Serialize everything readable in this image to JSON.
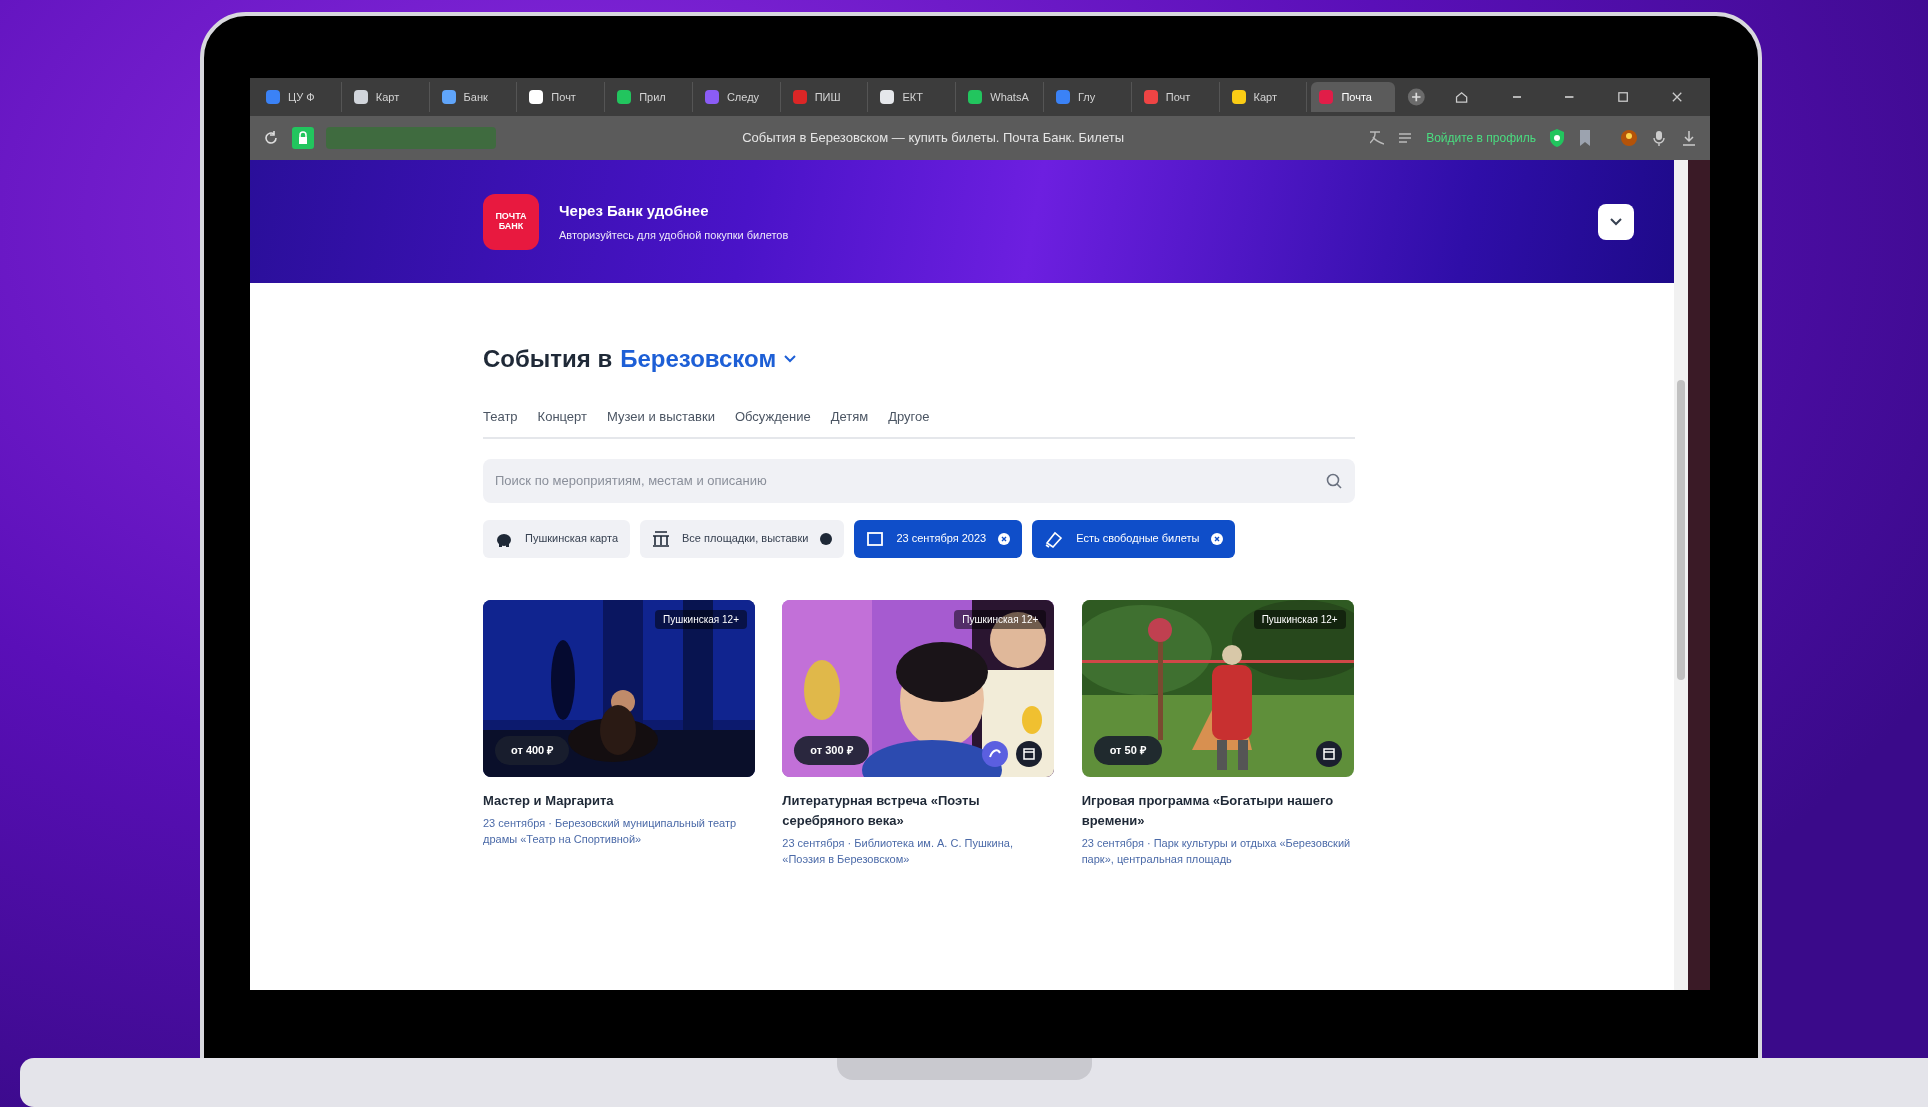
{
  "browser": {
    "tabs": [
      {
        "label": "ЦУ Ф",
        "color": "#3b82f6",
        "active": false
      },
      {
        "label": "Карт",
        "color": "#d1d5db",
        "active": false
      },
      {
        "label": "Банк",
        "color": "#60a5fa",
        "active": false
      },
      {
        "label": "Почт",
        "color": "#ffffff",
        "active": false
      },
      {
        "label": "Прил",
        "color": "#22c55e",
        "active": false
      },
      {
        "label": "Следу",
        "color": "#8b5cf6",
        "active": false
      },
      {
        "label": "ПИШ",
        "color": "#dc2626",
        "active": false
      },
      {
        "label": "ЕКТ",
        "color": "#e5e7eb",
        "active": false
      },
      {
        "label": "WhatsA",
        "color": "#22c55e",
        "active": false
      },
      {
        "label": "Глу",
        "color": "#3b82f6",
        "active": false
      },
      {
        "label": "Почт",
        "color": "#ef4444",
        "active": false
      },
      {
        "label": "Карт",
        "color": "#facc15",
        "active": false
      },
      {
        "label": "Почта",
        "color": "#e11d48",
        "active": true
      }
    ],
    "page_title": "События в Березовском — купить билеты. Почта Банк. Билеты",
    "profile_prompt": "Войдите в профиль"
  },
  "header": {
    "logo": [
      "ПОЧТА",
      "БАНК"
    ],
    "title": "Через Банк удобнее",
    "subtitle": "Авторизуйтесь для удобной покупки билетов"
  },
  "heading": {
    "prefix": "События в",
    "city": "Березовском"
  },
  "categories": [
    "Театр",
    "Концерт",
    "Музеи и выставки",
    "Обсуждение",
    "Детям",
    "Другое"
  ],
  "search": {
    "placeholder": "Поиск по мероприятиям, местам и описанию"
  },
  "filters": [
    {
      "label": "Пушкинская карта",
      "selected": false,
      "kind": "card"
    },
    {
      "label": "Все площадки, выставки",
      "selected": false,
      "kind": "venue"
    },
    {
      "label": "23 сентября 2023",
      "selected": true,
      "kind": "date"
    },
    {
      "label": "Есть свободные билеты",
      "selected": true,
      "kind": "tickets"
    }
  ],
  "events": [
    {
      "badge": "Пушкинская 12+",
      "price": "от 400 ₽",
      "title": "Мастер и Маргарита",
      "details": "23 сентября · Березовский муниципальный театр драмы «Театр на Спортивной»"
    },
    {
      "badge": "Пушкинская 12+",
      "price": "от 300 ₽",
      "title": "Литературная встреча «Поэты серебряного века»",
      "details": "23 сентября · Библиотека им. А. С. Пушкина, «Поэзия в Березовском»"
    },
    {
      "badge": "Пушкинская 12+",
      "price": "от 50 ₽",
      "title": "Игровая программа «Богатыри нашего времени»",
      "details": "23 сентября · Парк культуры и отдыха «Березовский парк», центральная площадь"
    }
  ]
}
